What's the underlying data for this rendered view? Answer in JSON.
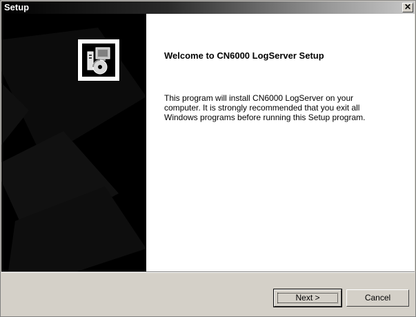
{
  "window": {
    "title": "Setup",
    "close_glyph": "✕"
  },
  "sidebar": {
    "icon": "setup-installer-icon"
  },
  "content": {
    "heading": "Welcome to CN6000 LogServer Setup",
    "body_lines": [
      "This program will install CN6000 LogServer on your",
      "computer.  It is strongly recommended that you exit all",
      "Windows programs before running this Setup program."
    ]
  },
  "buttons": {
    "next_label": "Next >",
    "cancel_label": "Cancel"
  }
}
